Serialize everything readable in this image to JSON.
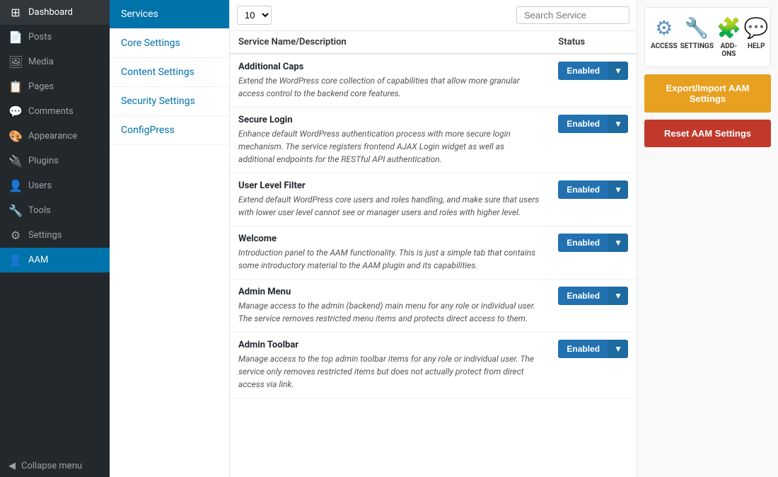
{
  "sidebar": {
    "items": [
      {
        "id": "dashboard",
        "label": "Dashboard",
        "icon": "⊞"
      },
      {
        "id": "posts",
        "label": "Posts",
        "icon": "📄"
      },
      {
        "id": "media",
        "label": "Media",
        "icon": "🖼"
      },
      {
        "id": "pages",
        "label": "Pages",
        "icon": "📋"
      },
      {
        "id": "comments",
        "label": "Comments",
        "icon": "💬"
      },
      {
        "id": "appearance",
        "label": "Appearance",
        "icon": "🎨"
      },
      {
        "id": "plugins",
        "label": "Plugins",
        "icon": "🔌"
      },
      {
        "id": "users",
        "label": "Users",
        "icon": "👤"
      },
      {
        "id": "tools",
        "label": "Tools",
        "icon": "🔧"
      },
      {
        "id": "settings",
        "label": "Settings",
        "icon": "⚙"
      },
      {
        "id": "aam",
        "label": "AAM",
        "icon": "👤"
      }
    ],
    "collapse_label": "Collapse menu"
  },
  "left_nav": {
    "items": [
      {
        "id": "services",
        "label": "Services",
        "active": true
      },
      {
        "id": "core_settings",
        "label": "Core Settings"
      },
      {
        "id": "content_settings",
        "label": "Content Settings"
      },
      {
        "id": "security_settings",
        "label": "Security Settings"
      },
      {
        "id": "configpress",
        "label": "ConfigPress"
      }
    ]
  },
  "top_bar": {
    "per_page_value": "10",
    "search_placeholder": "Search Service"
  },
  "table": {
    "headers": [
      {
        "id": "name",
        "label": "Service Name/Description"
      },
      {
        "id": "status",
        "label": "Status"
      }
    ],
    "rows": [
      {
        "name": "Additional Caps",
        "description": "Extend the WordPress core collection of capabilities that allow more granular access control to the backend core features.",
        "status": "Enabled"
      },
      {
        "name": "Secure Login",
        "description": "Enhance default WordPress authentication process with more secure login mechanism. The service registers frontend AJAX Login widget as well as additional endpoints for the RESTful API authentication.",
        "status": "Enabled"
      },
      {
        "name": "User Level Filter",
        "description": "Extend default WordPress core users and roles handling, and make sure that users with lower user level cannot see or manager users and roles with higher level.",
        "status": "Enabled"
      },
      {
        "name": "Welcome",
        "description": "Introduction panel to the AAM functionality. This is just a simple tab that contains some introductory material to the AAM plugin and its capabilities.",
        "status": "Enabled"
      },
      {
        "name": "Admin Menu",
        "description": "Manage access to the admin (backend) main menu for any role or individual user. The service removes restricted menu items and protects direct access to them.",
        "status": "Enabled"
      },
      {
        "name": "Admin Toolbar",
        "description": "Manage access to the top admin toolbar items for any role or individual user. The service only removes restricted items but does not actually protect from direct access via link.",
        "status": "Enabled"
      }
    ]
  },
  "right_panel": {
    "icons": [
      {
        "id": "access",
        "label": "ACCESS",
        "color": "#5a8fc2"
      },
      {
        "id": "settings",
        "label": "SETTINGS",
        "color": "#e07b2b"
      },
      {
        "id": "addons",
        "label": "ADD-ONS",
        "color": "#4a90d9"
      },
      {
        "id": "help",
        "label": "HELP",
        "color": "#5aacda"
      }
    ],
    "export_btn_label": "Export/Import AAM Settings",
    "reset_btn_label": "Reset AAM Settings"
  }
}
